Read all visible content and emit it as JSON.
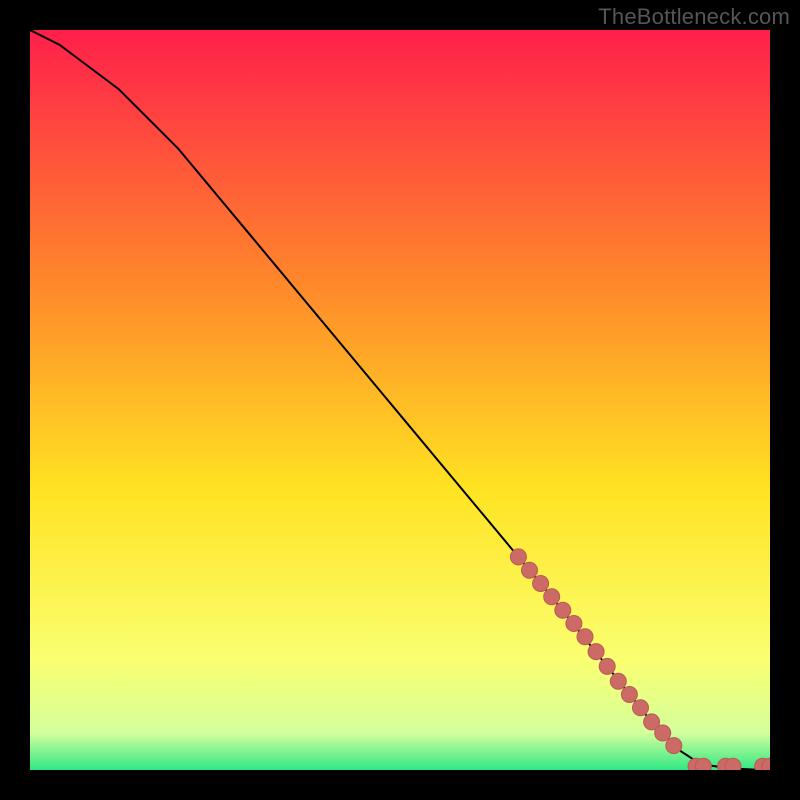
{
  "watermark": "TheBottleneck.com",
  "colors": {
    "gradient_top": "#ff1f4b",
    "gradient_mid1": "#ff8a2a",
    "gradient_mid2": "#ffe322",
    "gradient_mid3": "#faff70",
    "gradient_bot1": "#d4ff9c",
    "gradient_bot2": "#30e884",
    "curve": "#000000",
    "dot_fill": "#cc6b66",
    "dot_stroke": "#b85a55"
  },
  "chart_data": {
    "type": "line",
    "title": "",
    "xlabel": "",
    "ylabel": "",
    "xlim": [
      0,
      100
    ],
    "ylim": [
      0,
      100
    ],
    "series": [
      {
        "name": "bottleneck-curve",
        "x": [
          0,
          4,
          8,
          12,
          20,
          30,
          40,
          50,
          60,
          70,
          78,
          84,
          88,
          90,
          92,
          94,
          96,
          98,
          100
        ],
        "y": [
          100,
          98,
          95,
          92,
          84,
          72,
          60,
          48,
          36,
          24,
          14,
          6.5,
          2.5,
          1.2,
          0.6,
          0.3,
          0.15,
          0.05,
          0
        ]
      }
    ],
    "scatter": [
      {
        "name": "highlight-dots",
        "points": [
          {
            "x": 66,
            "y": 28.8
          },
          {
            "x": 67.5,
            "y": 27
          },
          {
            "x": 69,
            "y": 25.2
          },
          {
            "x": 70.5,
            "y": 23.4
          },
          {
            "x": 72,
            "y": 21.6
          },
          {
            "x": 73.5,
            "y": 19.8
          },
          {
            "x": 75,
            "y": 18
          },
          {
            "x": 76.5,
            "y": 16
          },
          {
            "x": 78,
            "y": 14
          },
          {
            "x": 79.5,
            "y": 12
          },
          {
            "x": 81,
            "y": 10.2
          },
          {
            "x": 82.5,
            "y": 8.4
          },
          {
            "x": 84,
            "y": 6.5
          },
          {
            "x": 85.5,
            "y": 5
          },
          {
            "x": 87,
            "y": 3.3
          },
          {
            "x": 90,
            "y": 0.5
          },
          {
            "x": 91,
            "y": 0.5
          },
          {
            "x": 94,
            "y": 0.5
          },
          {
            "x": 95,
            "y": 0.5
          },
          {
            "x": 99,
            "y": 0.5
          },
          {
            "x": 100,
            "y": 0.5
          }
        ]
      }
    ]
  }
}
